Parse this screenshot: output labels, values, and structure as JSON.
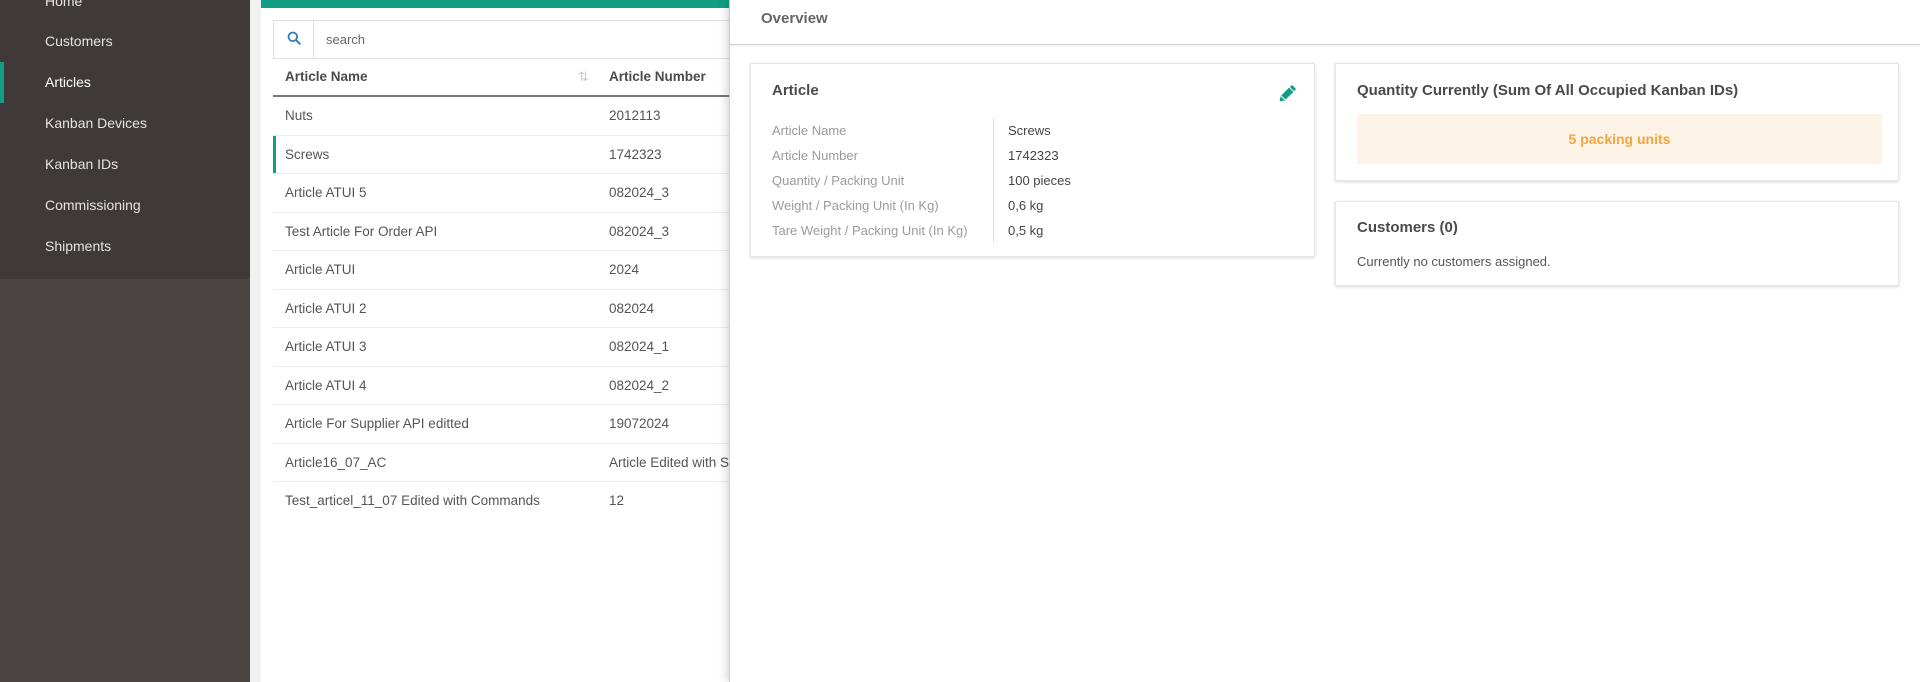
{
  "sidebar": {
    "items": [
      {
        "label": "Home"
      },
      {
        "label": "Customers"
      },
      {
        "label": "Articles"
      },
      {
        "label": "Kanban Devices"
      },
      {
        "label": "Kanban IDs"
      },
      {
        "label": "Commissioning"
      },
      {
        "label": "Shipments"
      }
    ],
    "active_item": "Articles"
  },
  "search": {
    "placeholder": "search",
    "icon": "search-icon"
  },
  "table": {
    "columns": [
      "Article Name",
      "Article Number"
    ],
    "sort_icon": "sort-icon",
    "rows": [
      {
        "name": "Nuts",
        "number": "2012113"
      },
      {
        "name": "Screws",
        "number": "1742323"
      },
      {
        "name": "Article ATUI 5",
        "number": "082024_3"
      },
      {
        "name": "Test Article For Order API",
        "number": "082024_3"
      },
      {
        "name": "Article ATUI",
        "number": "2024"
      },
      {
        "name": "Article ATUI 2",
        "number": "082024"
      },
      {
        "name": "Article ATUI 3",
        "number": "082024_1"
      },
      {
        "name": "Article ATUI 4",
        "number": "082024_2"
      },
      {
        "name": "Article For Supplier API editted",
        "number": "19072024"
      },
      {
        "name": "Article16_07_AC",
        "number": "Article Edited with Su"
      },
      {
        "name": "Test_articel_11_07 Edited with Commands",
        "number": "12"
      }
    ],
    "selected_row": "Screws"
  },
  "overview": {
    "title": "Overview",
    "article_card": {
      "title": "Article",
      "edit_icon": "pencil-icon",
      "fields": [
        {
          "key": "Article Name",
          "value": "Screws"
        },
        {
          "key": "Article Number",
          "value": "1742323"
        },
        {
          "key": "Quantity / Packing Unit",
          "value": "100 pieces"
        },
        {
          "key": "Weight / Packing Unit (In Kg)",
          "value": "0,6 kg"
        },
        {
          "key": "Tare Weight / Packing Unit (In Kg)",
          "value": "0,5 kg"
        }
      ]
    },
    "quantity_card": {
      "title": "Quantity Currently (Sum Of All Occupied Kanban IDs)",
      "value": "5 packing units"
    },
    "customers_card": {
      "title": "Customers (0)",
      "empty_text": "Currently no customers assigned."
    }
  },
  "colors": {
    "accent": "#129e83",
    "sidebar_bg": "#4a4443",
    "quantity_bg": "#fdf3e6",
    "quantity_text": "#f2a540"
  }
}
